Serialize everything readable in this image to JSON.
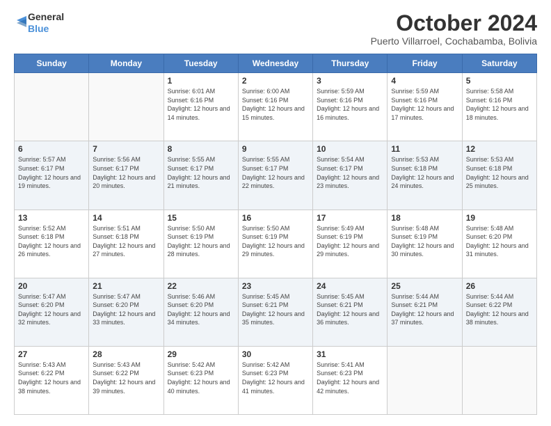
{
  "header": {
    "logo_line1": "General",
    "logo_line2": "Blue",
    "month": "October 2024",
    "location": "Puerto Villarroel, Cochabamba, Bolivia"
  },
  "weekdays": [
    "Sunday",
    "Monday",
    "Tuesday",
    "Wednesday",
    "Thursday",
    "Friday",
    "Saturday"
  ],
  "weeks": [
    [
      {
        "day": "",
        "info": ""
      },
      {
        "day": "",
        "info": ""
      },
      {
        "day": "1",
        "info": "Sunrise: 6:01 AM\nSunset: 6:16 PM\nDaylight: 12 hours and 14 minutes."
      },
      {
        "day": "2",
        "info": "Sunrise: 6:00 AM\nSunset: 6:16 PM\nDaylight: 12 hours and 15 minutes."
      },
      {
        "day": "3",
        "info": "Sunrise: 5:59 AM\nSunset: 6:16 PM\nDaylight: 12 hours and 16 minutes."
      },
      {
        "day": "4",
        "info": "Sunrise: 5:59 AM\nSunset: 6:16 PM\nDaylight: 12 hours and 17 minutes."
      },
      {
        "day": "5",
        "info": "Sunrise: 5:58 AM\nSunset: 6:16 PM\nDaylight: 12 hours and 18 minutes."
      }
    ],
    [
      {
        "day": "6",
        "info": "Sunrise: 5:57 AM\nSunset: 6:17 PM\nDaylight: 12 hours and 19 minutes."
      },
      {
        "day": "7",
        "info": "Sunrise: 5:56 AM\nSunset: 6:17 PM\nDaylight: 12 hours and 20 minutes."
      },
      {
        "day": "8",
        "info": "Sunrise: 5:55 AM\nSunset: 6:17 PM\nDaylight: 12 hours and 21 minutes."
      },
      {
        "day": "9",
        "info": "Sunrise: 5:55 AM\nSunset: 6:17 PM\nDaylight: 12 hours and 22 minutes."
      },
      {
        "day": "10",
        "info": "Sunrise: 5:54 AM\nSunset: 6:17 PM\nDaylight: 12 hours and 23 minutes."
      },
      {
        "day": "11",
        "info": "Sunrise: 5:53 AM\nSunset: 6:18 PM\nDaylight: 12 hours and 24 minutes."
      },
      {
        "day": "12",
        "info": "Sunrise: 5:53 AM\nSunset: 6:18 PM\nDaylight: 12 hours and 25 minutes."
      }
    ],
    [
      {
        "day": "13",
        "info": "Sunrise: 5:52 AM\nSunset: 6:18 PM\nDaylight: 12 hours and 26 minutes."
      },
      {
        "day": "14",
        "info": "Sunrise: 5:51 AM\nSunset: 6:18 PM\nDaylight: 12 hours and 27 minutes."
      },
      {
        "day": "15",
        "info": "Sunrise: 5:50 AM\nSunset: 6:19 PM\nDaylight: 12 hours and 28 minutes."
      },
      {
        "day": "16",
        "info": "Sunrise: 5:50 AM\nSunset: 6:19 PM\nDaylight: 12 hours and 29 minutes."
      },
      {
        "day": "17",
        "info": "Sunrise: 5:49 AM\nSunset: 6:19 PM\nDaylight: 12 hours and 29 minutes."
      },
      {
        "day": "18",
        "info": "Sunrise: 5:48 AM\nSunset: 6:19 PM\nDaylight: 12 hours and 30 minutes."
      },
      {
        "day": "19",
        "info": "Sunrise: 5:48 AM\nSunset: 6:20 PM\nDaylight: 12 hours and 31 minutes."
      }
    ],
    [
      {
        "day": "20",
        "info": "Sunrise: 5:47 AM\nSunset: 6:20 PM\nDaylight: 12 hours and 32 minutes."
      },
      {
        "day": "21",
        "info": "Sunrise: 5:47 AM\nSunset: 6:20 PM\nDaylight: 12 hours and 33 minutes."
      },
      {
        "day": "22",
        "info": "Sunrise: 5:46 AM\nSunset: 6:20 PM\nDaylight: 12 hours and 34 minutes."
      },
      {
        "day": "23",
        "info": "Sunrise: 5:45 AM\nSunset: 6:21 PM\nDaylight: 12 hours and 35 minutes."
      },
      {
        "day": "24",
        "info": "Sunrise: 5:45 AM\nSunset: 6:21 PM\nDaylight: 12 hours and 36 minutes."
      },
      {
        "day": "25",
        "info": "Sunrise: 5:44 AM\nSunset: 6:21 PM\nDaylight: 12 hours and 37 minutes."
      },
      {
        "day": "26",
        "info": "Sunrise: 5:44 AM\nSunset: 6:22 PM\nDaylight: 12 hours and 38 minutes."
      }
    ],
    [
      {
        "day": "27",
        "info": "Sunrise: 5:43 AM\nSunset: 6:22 PM\nDaylight: 12 hours and 38 minutes."
      },
      {
        "day": "28",
        "info": "Sunrise: 5:43 AM\nSunset: 6:22 PM\nDaylight: 12 hours and 39 minutes."
      },
      {
        "day": "29",
        "info": "Sunrise: 5:42 AM\nSunset: 6:23 PM\nDaylight: 12 hours and 40 minutes."
      },
      {
        "day": "30",
        "info": "Sunrise: 5:42 AM\nSunset: 6:23 PM\nDaylight: 12 hours and 41 minutes."
      },
      {
        "day": "31",
        "info": "Sunrise: 5:41 AM\nSunset: 6:23 PM\nDaylight: 12 hours and 42 minutes."
      },
      {
        "day": "",
        "info": ""
      },
      {
        "day": "",
        "info": ""
      }
    ]
  ]
}
